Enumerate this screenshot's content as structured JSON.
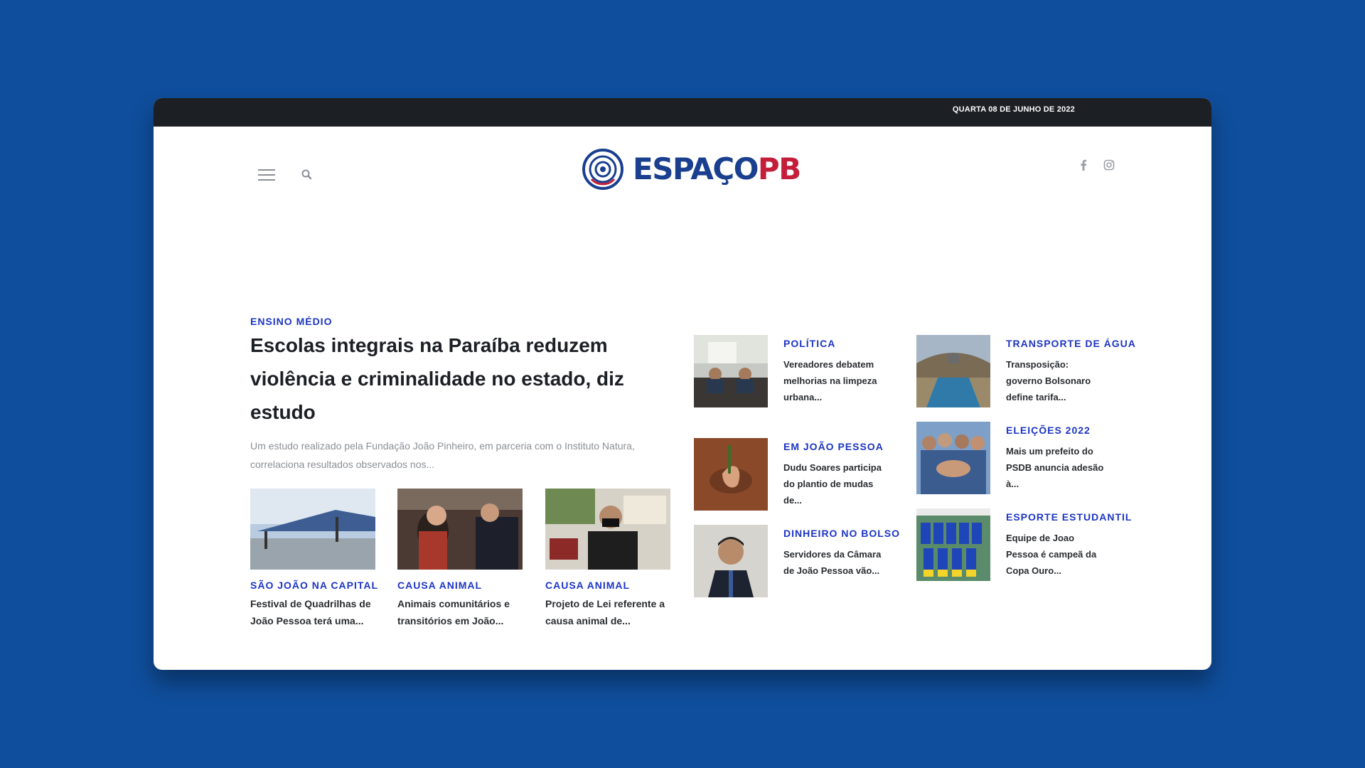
{
  "topbar": {
    "date": "QUARTA 08 DE JUNHO DE 2022"
  },
  "header": {
    "menu_icon": "hamburger-icon",
    "search_icon": "search-icon",
    "logo": {
      "part1": "ESPAÇO",
      "part2": "PB",
      "color1": "#1a3f8f",
      "color2": "#c41e3a"
    },
    "social": [
      "facebook-icon",
      "instagram-icon"
    ]
  },
  "lead": {
    "category": "ENSINO MÉDIO",
    "title": "Escolas integrais na Paraíba reduzem violência e criminalidade no estado, diz estudo",
    "excerpt": "Um estudo realizado pela Fundação João Pinheiro, em parceria com o Instituto Natura, correlaciona resultados observados nos..."
  },
  "small_cards": [
    {
      "category": "SÃO JOÃO NA CAPITAL",
      "title": "Festival de Quadrilhas de João Pessoa terá uma..."
    },
    {
      "category": "CAUSA ANIMAL",
      "title": "Animais comunitários e transitórios em João..."
    },
    {
      "category": "CAUSA ANIMAL",
      "title": "Projeto de Lei referente a causa animal de..."
    }
  ],
  "side_col1": [
    {
      "category": "POLÍTICA",
      "title": "Vereadores debatem melhorias na limpeza urbana..."
    },
    {
      "category": "EM JOÃO PESSOA",
      "title": "Dudu Soares participa do plantio de mudas de..."
    },
    {
      "category": "DINHEIRO NO BOLSO",
      "title": "Servidores da Câmara de João Pessoa vão..."
    }
  ],
  "side_col2": [
    {
      "category": "TRANSPORTE DE ÁGUA",
      "title": "Transposição: governo Bolsonaro define tarifa..."
    },
    {
      "category": "ELEIÇÕES 2022",
      "title": "Mais um prefeito do PSDB anuncia adesão à..."
    },
    {
      "category": "ESPORTE ESTUDANTIL",
      "title": "Equipe de Joao Pessoa é campeã da Copa Ouro..."
    }
  ],
  "colors": {
    "accent": "#1d35c4",
    "background": "#0f4e9c",
    "topbar": "#1c1f24"
  }
}
